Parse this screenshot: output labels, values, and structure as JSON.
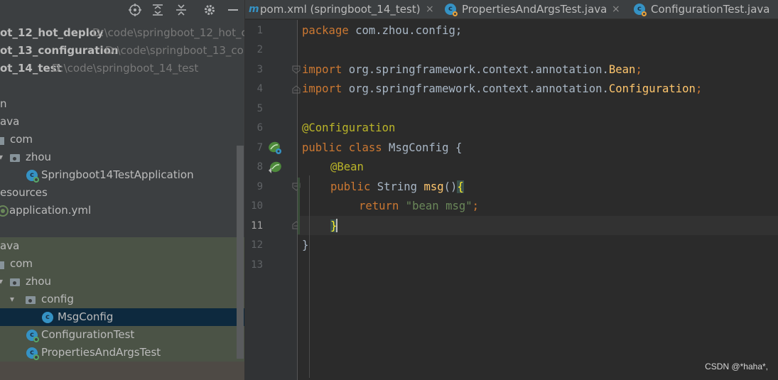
{
  "colors": {
    "panel_bg": "#3c3f41",
    "editor_bg": "#2b2b2b",
    "selection_bg": "#0d293e",
    "test_area_bg": "#4b5346",
    "keyword": "#cc7832",
    "annotation": "#bbb529",
    "method": "#ffc66d",
    "string": "#6a8759",
    "plain": "#a9b7c6"
  },
  "toolbar": {
    "icons": [
      "locate-icon",
      "expand-all-icon",
      "collapse-all-icon",
      "settings-gear-icon",
      "hide-panel-icon"
    ]
  },
  "project_tree": {
    "modules": [
      {
        "name": "ot_12_hot_deploy",
        "path": "D:\\code\\springboot_12_hot_c"
      },
      {
        "name": "ot_13_configuration",
        "path": "D:\\code\\springboot_13_co"
      },
      {
        "name": "ot_14_test",
        "path": "D:\\code\\springboot_14_test"
      }
    ],
    "main": {
      "n_fragment": "n",
      "java_fragment": "ava",
      "com": "com",
      "zhou": "zhou",
      "app_class": "Springboot14TestApplication",
      "resources_fragment": "esources",
      "app_yml": "application.yml"
    },
    "test": {
      "java_fragment": "ava",
      "com": "com",
      "zhou": "zhou",
      "config": "config",
      "msg_config": "MsgConfig",
      "configuration_test": "ConfigurationTest",
      "properties_test": "PropertiesAndArgsTest"
    }
  },
  "tabs": [
    {
      "label": "pom.xml (springboot_14_test)",
      "icon": "maven-icon",
      "close": "×"
    },
    {
      "label": "PropertiesAndArgsTest.java",
      "icon": "java-class-icon",
      "close": "×"
    },
    {
      "label": "ConfigurationTest.java",
      "icon": "java-class-icon",
      "close": ""
    }
  ],
  "editor": {
    "current_line": 11,
    "line_numbers": [
      "1",
      "2",
      "3",
      "4",
      "5",
      "6",
      "7",
      "8",
      "9",
      "10",
      "11",
      "12",
      "13"
    ],
    "code": {
      "l1_kw": "package",
      "l1_rest": " com.zhou.config;",
      "l3_kw": "import",
      "l3_pkg": " org.springframework.context.annotation.",
      "l3_cls": "Bean",
      "l3_semi": ";",
      "l4_kw": "import",
      "l4_pkg": " org.springframework.context.annotation.",
      "l4_cls": "Configuration",
      "l4_semi": ";",
      "l6_ann": "@Configuration",
      "l7_kw": "public class",
      "l7_rest": " MsgConfig {",
      "l8_ann": "@Bean",
      "l9_kw": "public",
      "l9_type": " String ",
      "l9_fn": "msg",
      "l9_paren": "()",
      "l9_brace": "{",
      "l10_kw": "return",
      "l10_str": "\"bean msg\"",
      "l10_semi": ";",
      "l11_brace": "}",
      "l12_brace": "}"
    }
  },
  "watermark": "CSDN @*haha*,"
}
